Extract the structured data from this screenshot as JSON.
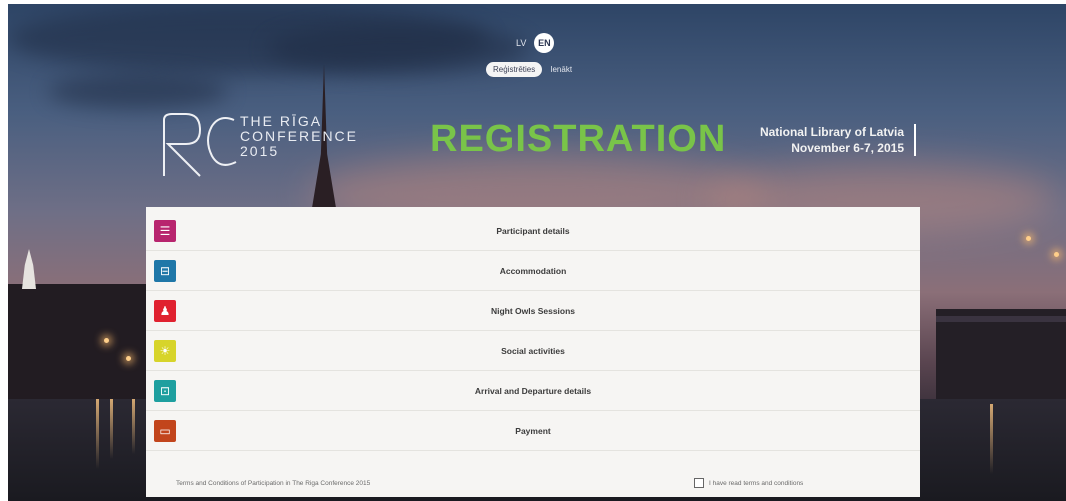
{
  "lang": {
    "lv": "LV",
    "en": "EN"
  },
  "auth": {
    "register_btn": "Reģistrēties",
    "login": "Ienākt"
  },
  "logo": {
    "line1": "THE RĪGA",
    "line2": "CONFERENCE",
    "line3": "2015"
  },
  "title": "REGISTRATION",
  "venue": {
    "line1": "National Library of Latvia",
    "line2": "November 6-7, 2015"
  },
  "sections": [
    {
      "label": "Participant details",
      "icon": "list-icon",
      "color": "#b8256e",
      "glyph": "☰"
    },
    {
      "label": "Accommodation",
      "icon": "bed-icon",
      "color": "#1f77a8",
      "glyph": "⊟"
    },
    {
      "label": "Night Owls Sessions",
      "icon": "people-icon",
      "color": "#e0212f",
      "glyph": "♟"
    },
    {
      "label": "Social activities",
      "icon": "sun-icon",
      "color": "#d7d42a",
      "glyph": "☀"
    },
    {
      "label": "Arrival and Departure details",
      "icon": "bus-icon",
      "color": "#1e9f9f",
      "glyph": "⊡"
    },
    {
      "label": "Payment",
      "icon": "card-icon",
      "color": "#c2451c",
      "glyph": "▭"
    }
  ],
  "terms": "Terms and Conditions of Participation in The Riga Conference 2015",
  "checkbox_label": "I have read terms and conditions"
}
